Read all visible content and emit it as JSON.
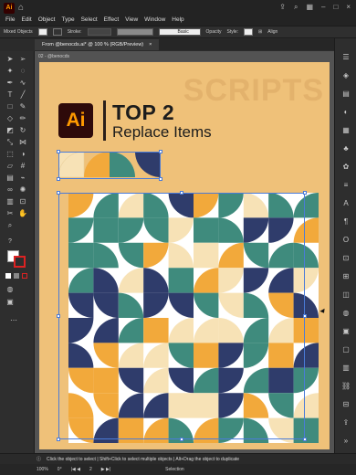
{
  "app": {
    "logo_text": "Ai"
  },
  "menu": [
    "File",
    "Edit",
    "Object",
    "Type",
    "Select",
    "Effect",
    "View",
    "Window",
    "Help"
  ],
  "control_bar": {
    "selection_label": "Mixed Objects",
    "stroke_label": "Stroke:",
    "basic_label": "Basic",
    "opacity_label": "Opacity",
    "style_label": "Style:",
    "align_label": "Align"
  },
  "document_tab": {
    "label": "From @benocds.ai* @ 100 % (RGB/Preview)",
    "close_glyph": "×"
  },
  "artboard": {
    "label": "02 - @benocds",
    "watermark": "SCRIPTS",
    "logo_text": "Ai",
    "title": "TOP 2",
    "subtitle": "Replace Items"
  },
  "colors": {
    "navy": "#2f3c6b",
    "teal": "#3f8b7d",
    "orange": "#f2a93b",
    "cream": "#f7e2b6",
    "white": "#ffffff",
    "bg": "#efc179",
    "selection": "#4a7bd8"
  },
  "status": {
    "hint": "Click the object to select  |  Shift+Click to select multiple objects  |  Alt+Drag the object to duplicate"
  },
  "bottom": {
    "zoom": "100%",
    "rotation": "0°",
    "artboard_number": "2",
    "mode": "Selection"
  }
}
